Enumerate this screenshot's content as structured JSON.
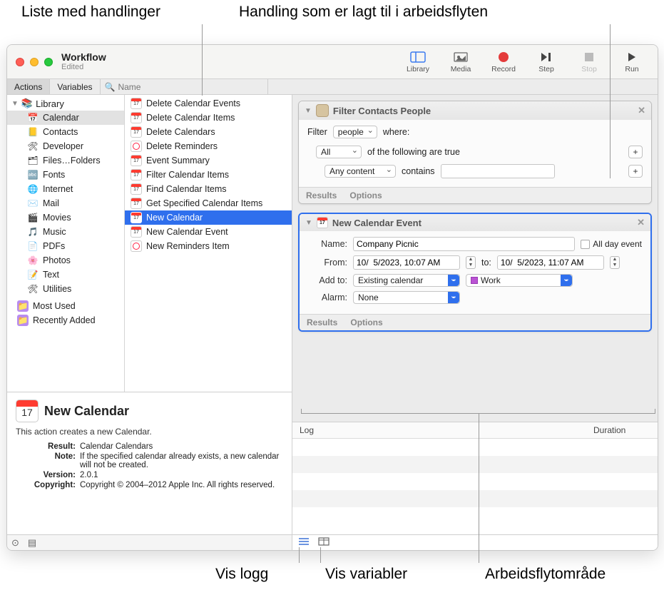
{
  "callouts": {
    "list_actions": "Liste med handlinger",
    "action_added": "Handling som er lagt til i arbeidsflyten",
    "show_log": "Vis logg",
    "show_vars": "Vis variabler",
    "workflow_area": "Arbeidsflytområde"
  },
  "window": {
    "title": "Workflow",
    "subtitle": "Edited"
  },
  "toolbar": {
    "library": "Library",
    "media": "Media",
    "record": "Record",
    "step": "Step",
    "stop": "Stop",
    "run": "Run"
  },
  "filterbar": {
    "actions": "Actions",
    "variables": "Variables",
    "search_placeholder": "Name"
  },
  "library": {
    "root": "Library",
    "categories": [
      "Calendar",
      "Contacts",
      "Developer",
      "Files…Folders",
      "Fonts",
      "Internet",
      "Mail",
      "Movies",
      "Music",
      "PDFs",
      "Photos",
      "Text",
      "Utilities"
    ],
    "extras": [
      "Most Used",
      "Recently Added"
    ],
    "selected": "Calendar"
  },
  "actions": {
    "items": [
      "Delete Calendar Events",
      "Delete Calendar Items",
      "Delete Calendars",
      "Delete Reminders",
      "Event Summary",
      "Filter Calendar Items",
      "Find Calendar Items",
      "Get Specified Calendar Items",
      "New Calendar",
      "New Calendar Event",
      "New Reminders Item"
    ],
    "selected": "New Calendar"
  },
  "description": {
    "title": "New Calendar",
    "summary": "This action creates a new Calendar.",
    "result_k": "Result:",
    "result_v": "Calendar Calendars",
    "note_k": "Note:",
    "note_v": "If the specified calendar already exists, a new calendar will not be created.",
    "version_k": "Version:",
    "version_v": "2.0.1",
    "copyright_k": "Copyright:",
    "copyright_v": "Copyright © 2004–2012 Apple Inc.  All rights reserved."
  },
  "workflow": {
    "action1": {
      "title": "Filter Contacts People",
      "filter_label": "Filter",
      "filter_value": "people",
      "where_label": "where:",
      "all_value": "All",
      "all_suffix": "of the following are true",
      "cond_value": "Any content",
      "cond_op": "contains",
      "results": "Results",
      "options": "Options"
    },
    "action2": {
      "title": "New Calendar Event",
      "name_label": "Name:",
      "name_value": "Company Picnic",
      "allday_label": "All day event",
      "from_label": "From:",
      "from_value": "10/  5/2023, 10:07 AM",
      "to_label": "to:",
      "to_value": "10/  5/2023, 11:07 AM",
      "addto_label": "Add to:",
      "addto_value": "Existing calendar",
      "work_value": "Work",
      "alarm_label": "Alarm:",
      "alarm_value": "None",
      "results": "Results",
      "options": "Options"
    }
  },
  "log": {
    "col1": "Log",
    "col2": "Duration"
  }
}
